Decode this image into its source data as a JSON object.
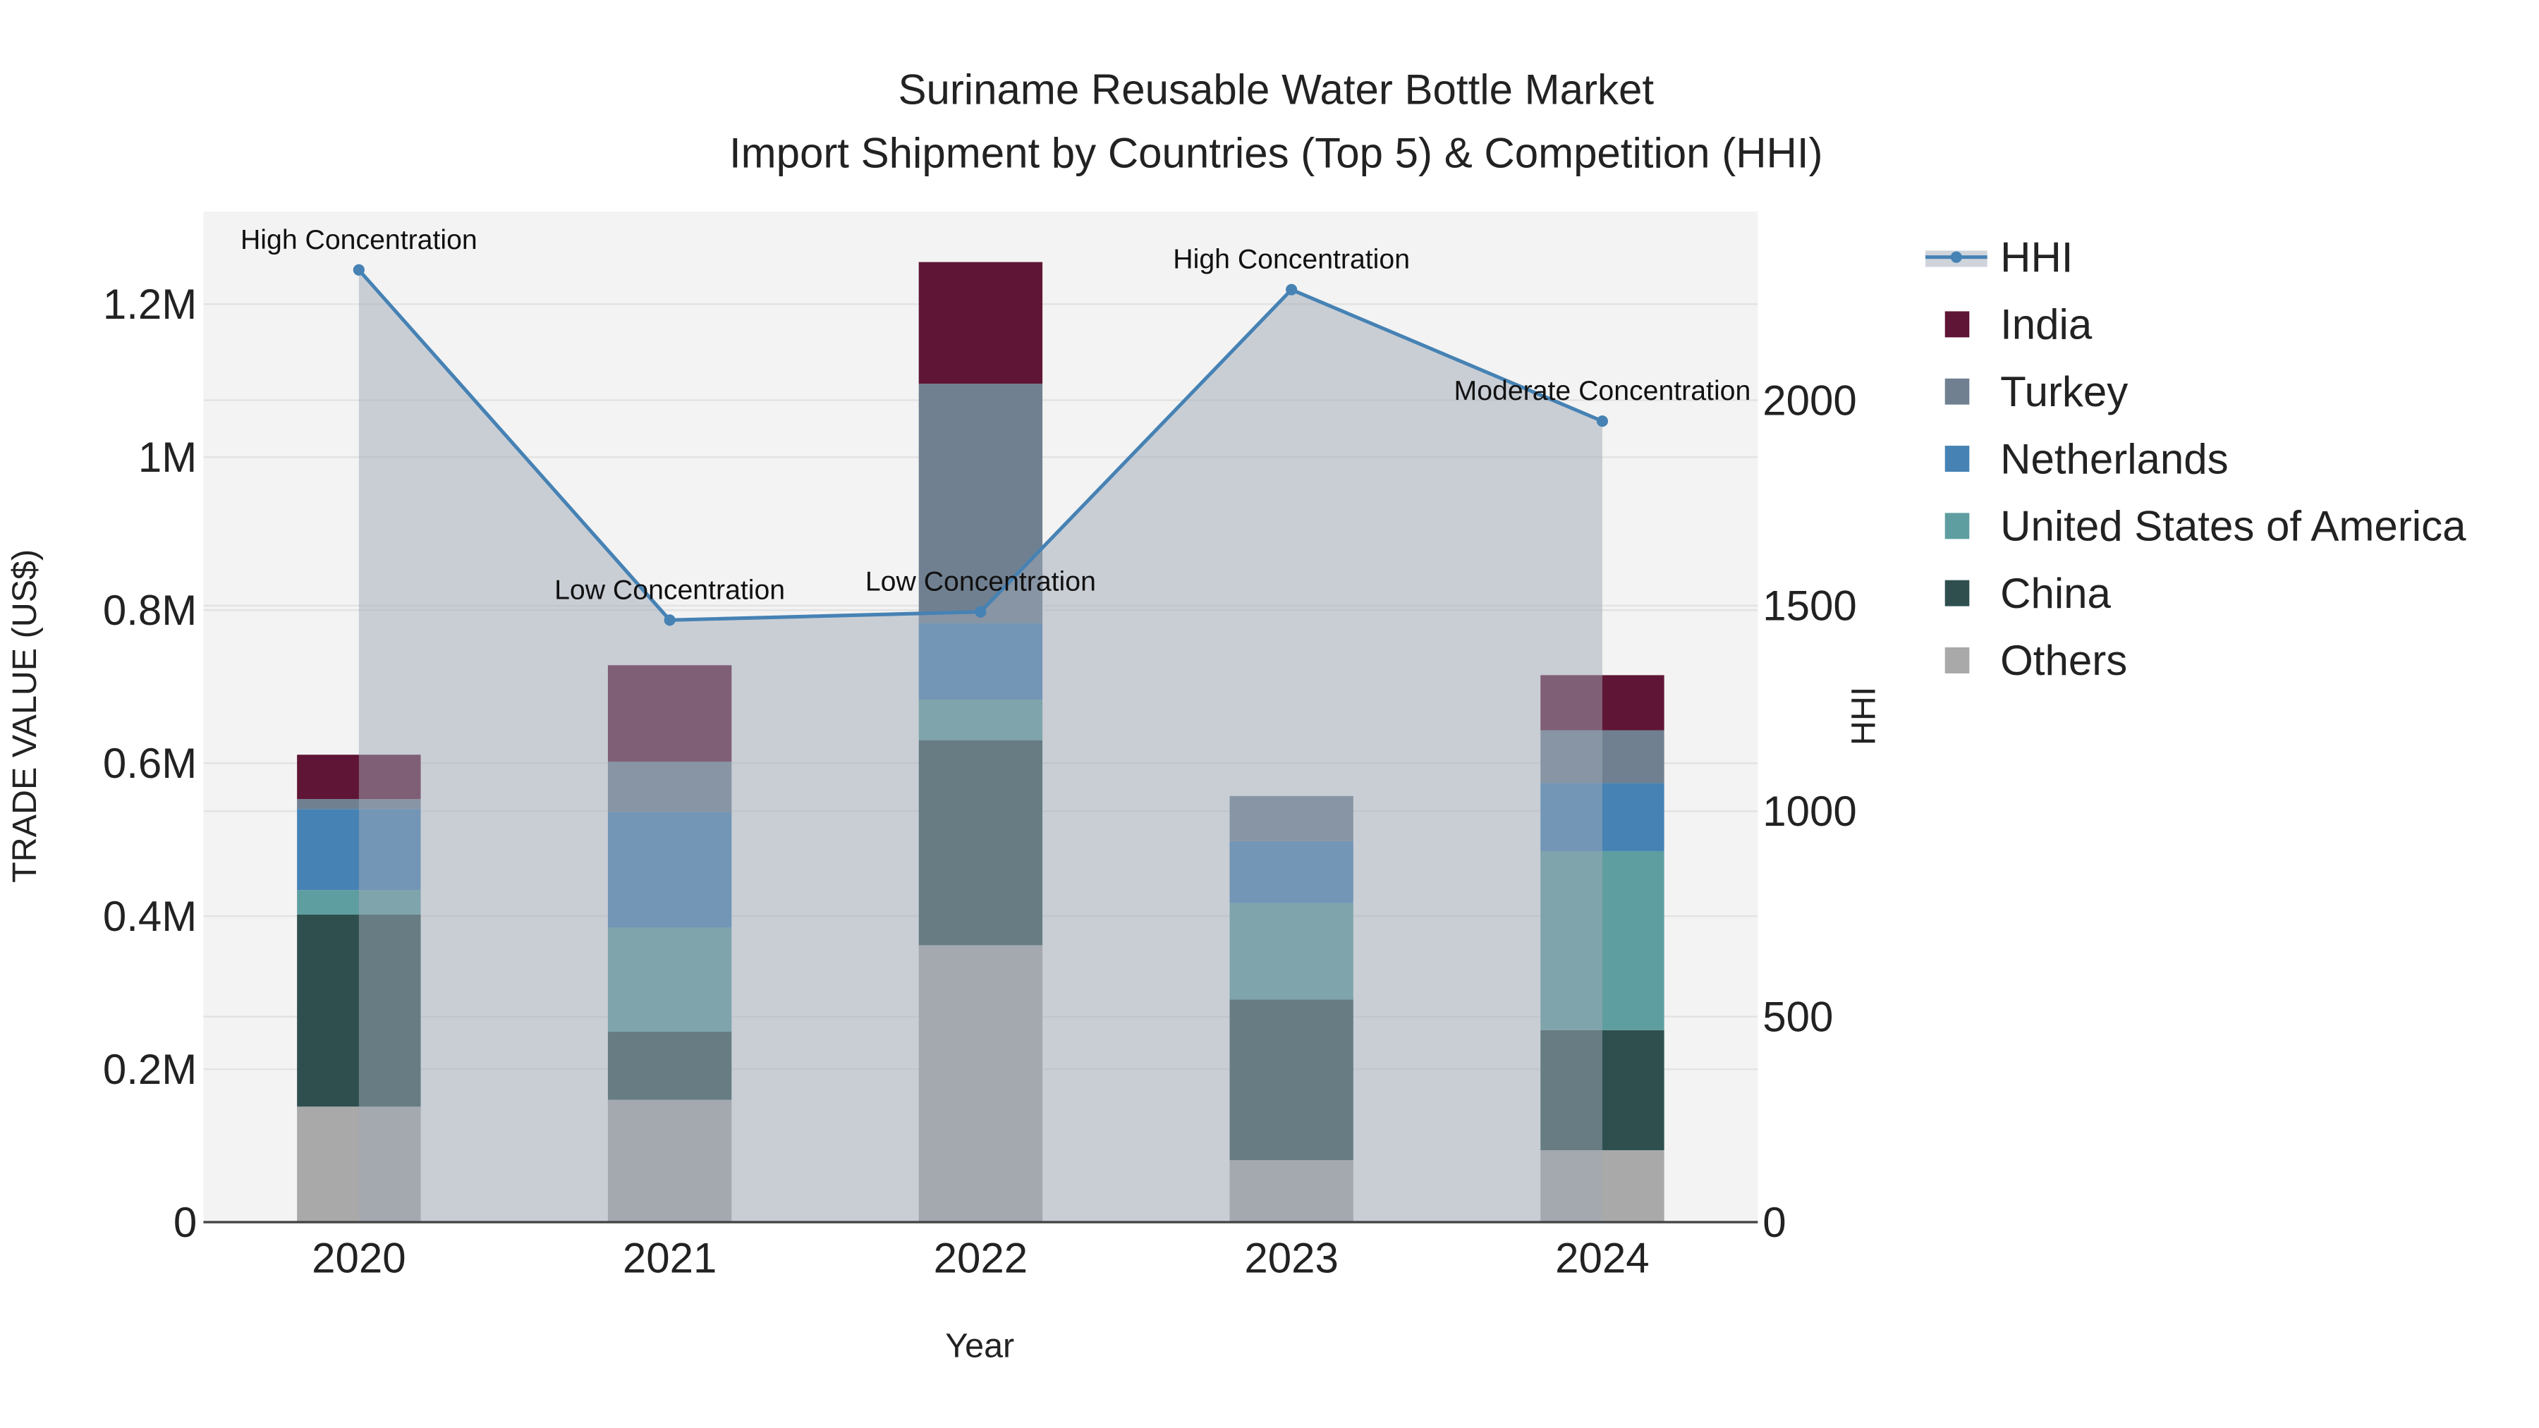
{
  "chart_data": {
    "type": "bar",
    "title": "Suriname Reusable Water Bottle Market",
    "subtitle": "Import Shipment by Countries (Top 5) & Competition (HHI)",
    "xlabel": "Year",
    "ylabel": "TRADE VALUE (US$)",
    "y2label": "HHI",
    "categories": [
      "2020",
      "2021",
      "2022",
      "2023",
      "2024"
    ],
    "ylim": [
      0,
      1321000
    ],
    "y2lim": [
      0,
      2459
    ],
    "yticks": [
      0,
      200000,
      400000,
      600000,
      800000,
      1000000,
      1200000
    ],
    "ytick_labels": [
      "0",
      "0.2M",
      "0.4M",
      "0.6M",
      "0.8M",
      "1M",
      "1.2M"
    ],
    "y2ticks": [
      0,
      500,
      1000,
      1500,
      2000
    ],
    "y2tick_labels": [
      "0",
      "500",
      "1000",
      "1500",
      "2000"
    ],
    "grid": true,
    "legend_position": "right",
    "series": [
      {
        "name": "Others",
        "color": "#a9a9a9",
        "values": [
          151000,
          160000,
          362000,
          81000,
          94000
        ]
      },
      {
        "name": "China",
        "color": "#2f4f4f",
        "values": [
          251000,
          89000,
          268000,
          210000,
          157000
        ]
      },
      {
        "name": "United States of America",
        "color": "#5f9ea0",
        "values": [
          32000,
          136000,
          53000,
          126000,
          234000
        ]
      },
      {
        "name": "Netherlands",
        "color": "#4682b4",
        "values": [
          106000,
          151000,
          100000,
          81000,
          89000
        ]
      },
      {
        "name": "Turkey",
        "color": "#708090",
        "values": [
          13000,
          66000,
          313000,
          59000,
          69000
        ]
      },
      {
        "name": "India",
        "color": "#5f1535",
        "values": [
          58000,
          126000,
          159000,
          0,
          72000
        ]
      }
    ],
    "hhi": {
      "name": "HHI",
      "color": "#4682b4",
      "values": [
        2317,
        1465,
        1485,
        2269,
        1949
      ],
      "annotations": [
        "High Concentration",
        "Low Concentration",
        "Low Concentration",
        "High Concentration",
        "Moderate Concentration"
      ]
    },
    "legend_order": [
      "HHI",
      "India",
      "Turkey",
      "Netherlands",
      "United States of America",
      "China",
      "Others"
    ]
  }
}
